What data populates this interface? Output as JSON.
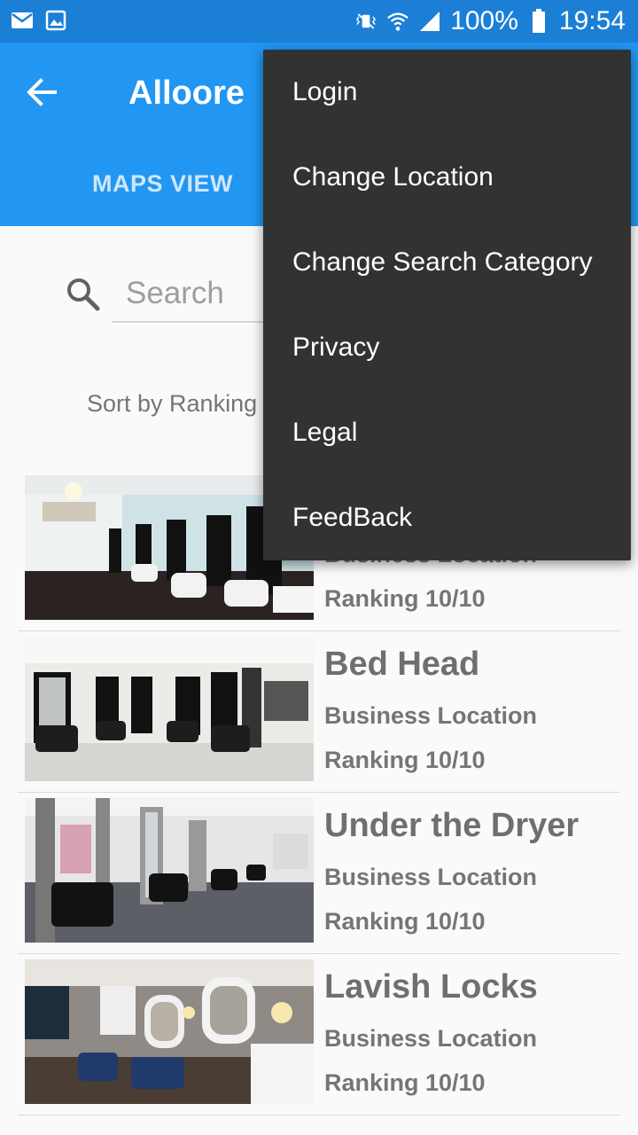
{
  "status_bar": {
    "battery": "100%",
    "time": "19:54",
    "icons": [
      "email-icon",
      "image-icon",
      "vibrate-icon",
      "wifi-icon",
      "signal-icon",
      "battery-icon"
    ]
  },
  "app_bar": {
    "title": "Alloore",
    "tab": "MAPS VIEW"
  },
  "search": {
    "placeholder": "Search"
  },
  "sort_label": "Sort by Ranking",
  "menu": {
    "items": [
      "Login",
      "Change Location",
      "Change Search Category",
      "Privacy",
      "Legal",
      "FeedBack"
    ]
  },
  "list": {
    "rows": [
      {
        "name": "",
        "location": "Business Location",
        "ranking": "Ranking 10/10"
      },
      {
        "name": "Bed Head",
        "location": "Business Location",
        "ranking": "Ranking 10/10"
      },
      {
        "name": "Under the Dryer",
        "location": "Business Location",
        "ranking": "Ranking 10/10"
      },
      {
        "name": "Lavish Locks",
        "location": "Business Location",
        "ranking": "Ranking 10/10"
      }
    ]
  },
  "colors": {
    "status_bar": "#1b7fd6",
    "app_bar": "#2196f3",
    "menu_bg": "#323232",
    "text_gray": "#757575"
  }
}
